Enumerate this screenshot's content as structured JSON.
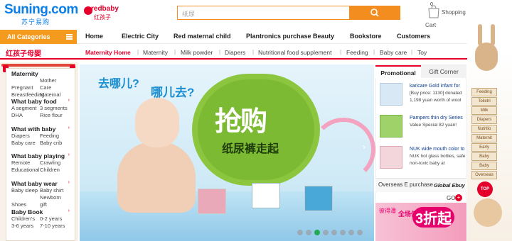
{
  "header": {
    "logo": "Suning.com",
    "logo_sub": "苏宁易购",
    "partner_logo": "redbaby",
    "partner_logo_cn": "红孩子",
    "search_placeholder": "纸尿",
    "cart_count": "0",
    "shopping_label": "Shopping",
    "cart_label": "Cart"
  },
  "nav": {
    "all_categories": "All Categories",
    "items": [
      "Home",
      "Electric City",
      "Red maternal child",
      "Plantronics purchase Beauty",
      "Bookstore",
      "Customers"
    ]
  },
  "subnav": {
    "brand": "红孩子母婴",
    "items": [
      "Maternity Home",
      "Maternity",
      "Milk powder",
      "Diapers",
      "Nutritional food supplement",
      "Feeding",
      "Baby care",
      "Toy"
    ]
  },
  "sidebar": {
    "categories": [
      {
        "title": "Maternity",
        "subs": [
          "Pregnant",
          "Mother Care",
          "Breastfeeding",
          "Maternal"
        ]
      },
      {
        "title": "What baby food",
        "subs": [
          "A segment",
          "3 segments",
          "DHA",
          "Rice flour"
        ]
      },
      {
        "title": "What with baby",
        "subs": [
          "Diapers",
          "Feeding",
          "Baby care",
          "Baby crib"
        ]
      },
      {
        "title": "What baby playing",
        "subs": [
          "Remote",
          "Crawling",
          "Educational",
          "Children"
        ]
      },
      {
        "title": "What baby wear",
        "subs": [
          "Baby sleep",
          "Baby shirt",
          "Shoes",
          "Newborn gift"
        ]
      },
      {
        "title": "Baby Book",
        "subs": [
          "Children's",
          "0-2 years",
          "3-6 years",
          "7-10 years"
        ]
      }
    ]
  },
  "banner": {
    "q1": "去哪儿?",
    "q2": "哪儿去?",
    "headline": "抢购",
    "subhead": "纸尿裤走起"
  },
  "right_panel": {
    "tabs": [
      "Promotional",
      "Gift Corner"
    ],
    "promos": [
      {
        "title": "karicare Gold infant for",
        "desc": "[Buy price: 1130] donated 1,198 yuan worth of wool"
      },
      {
        "title": "Pampers thin dry Series",
        "desc": "Value Special 82 yuan!"
      },
      {
        "title": "NUK wide mouth color to",
        "desc": "NUK hot glass bottles, safe non-toxic baby at"
      }
    ],
    "overseas_title": "Overseas E purchase",
    "overseas_sub": "Global Ebuy",
    "go_label": "GO",
    "ov_cn": "彼得潘",
    "ov_small": "全场低至",
    "ov_big": "3折起"
  },
  "deco_menu": {
    "items": [
      "Feeding",
      "Toiletri",
      "Milk",
      "Diapers",
      "Nutritio",
      "Maternit",
      "Early",
      "Baby",
      "Baby",
      "Overseas"
    ],
    "top": "TOP"
  }
}
